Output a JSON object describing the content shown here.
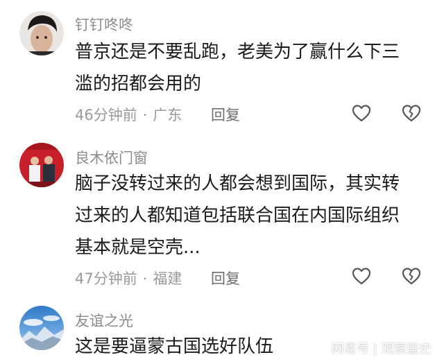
{
  "comments": [
    {
      "username": "钉钉咚咚",
      "text_lines": [
        "普京还是不要乱跑，老美为了赢什么下三",
        "滥的招都会用的"
      ],
      "time": "46分钟前",
      "location": "广东",
      "reply_label": "回复"
    },
    {
      "username": "良木依门窗",
      "text_lines": [
        "脑子没转过来的人都会想到国际，其实转",
        "过来的人都知道包括联合国在内国际组织",
        "基本就是空壳..."
      ],
      "time": "47分钟前",
      "location": "福建",
      "reply_label": "回复"
    },
    {
      "username": "友谊之光",
      "text_lines": [
        "这是要逼蒙古国选好队伍"
      ]
    }
  ],
  "icons": {
    "like": "heart-outline-icon",
    "dislike": "broken-heart-outline-icon"
  },
  "watermark": {
    "brand": "网易号",
    "separator": "|",
    "account": "观察鉴史"
  },
  "colors": {
    "username": "#8c8c8c",
    "text": "#1a1a1a",
    "meta": "#9a9a9a",
    "icon": "#555555"
  }
}
